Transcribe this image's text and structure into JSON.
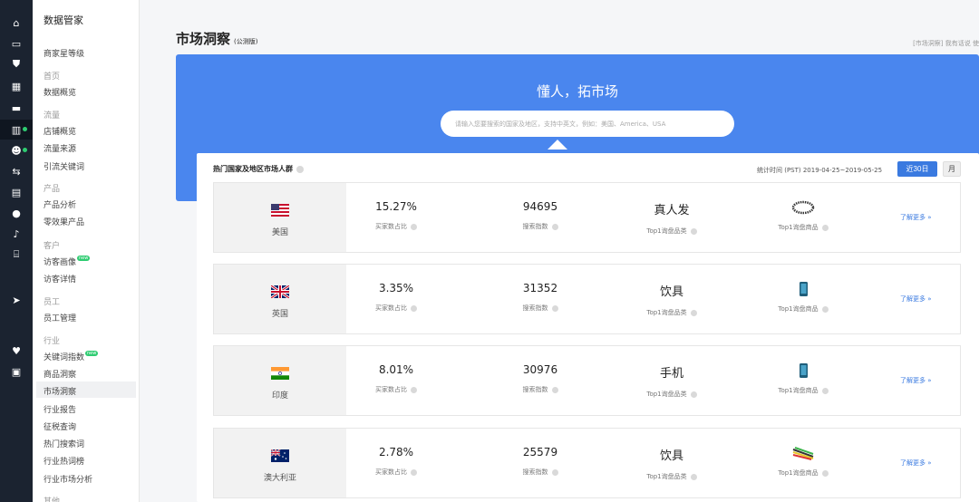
{
  "rail": {
    "icons": [
      "home-icon",
      "store-icon",
      "shield-icon",
      "grid-icon",
      "message-icon",
      "chart-icon",
      "users-icon",
      "arrows-icon",
      "clipboard-icon",
      "globe-icon",
      "bell-icon",
      "bank-icon",
      "send-icon",
      "heart-icon",
      "briefcase-icon"
    ]
  },
  "sidebar": {
    "title": "数据管家",
    "items": [
      {
        "type": "item",
        "label": "商家星等级"
      },
      {
        "type": "group",
        "label": "首页"
      },
      {
        "type": "item",
        "label": "数据概览"
      },
      {
        "type": "group",
        "label": "流量"
      },
      {
        "type": "item",
        "label": "店铺概览"
      },
      {
        "type": "item",
        "label": "流量来源"
      },
      {
        "type": "item",
        "label": "引流关键词"
      },
      {
        "type": "group",
        "label": "产品"
      },
      {
        "type": "item",
        "label": "产品分析"
      },
      {
        "type": "item",
        "label": "零效果产品"
      },
      {
        "type": "group",
        "label": "客户"
      },
      {
        "type": "item",
        "label": "访客画像",
        "badge": "new"
      },
      {
        "type": "item",
        "label": "访客详情"
      },
      {
        "type": "group",
        "label": "员工"
      },
      {
        "type": "item",
        "label": "员工管理"
      },
      {
        "type": "group",
        "label": "行业"
      },
      {
        "type": "item",
        "label": "关键词指数",
        "badge": "new"
      },
      {
        "type": "item",
        "label": "商品洞察"
      },
      {
        "type": "item",
        "label": "市场洞察",
        "active": true
      },
      {
        "type": "item",
        "label": "行业报告"
      },
      {
        "type": "item",
        "label": "征税查询"
      },
      {
        "type": "item",
        "label": "热门搜索词"
      },
      {
        "type": "item",
        "label": "行业热词榜"
      },
      {
        "type": "item",
        "label": "行业市场分析"
      },
      {
        "type": "group",
        "label": "其他"
      }
    ]
  },
  "header": {
    "title": "市场洞察",
    "beta": "(公测版)",
    "links": "[市场洞察] 我有话说    使"
  },
  "hero": {
    "title": "懂人，拓市场",
    "search_placeholder": "请输入您要搜索的国家及地区，支持中英文，例如：美国、America、USA"
  },
  "panel": {
    "title": "热门国家及地区市场人群",
    "time_label": "统计时间 (PST) 2019-04-25~2019-05-25",
    "btn_30": "近30日",
    "btn_month": "月",
    "labels": {
      "buyer_ratio": "买家数占比",
      "search_index": "搜索指数",
      "top_category": "Top1询盘品类",
      "top_product": "Top1询盘商品",
      "more": "了解更多 »"
    },
    "rows": [
      {
        "country": "美国",
        "flag": "us",
        "buyer_ratio": "15.27%",
        "search_index": "94695",
        "top_category": "真人发",
        "product": "hair"
      },
      {
        "country": "英国",
        "flag": "uk",
        "buyer_ratio": "3.35%",
        "search_index": "31352",
        "top_category": "饮具",
        "product": "phonecase"
      },
      {
        "country": "印度",
        "flag": "in",
        "buyer_ratio": "8.01%",
        "search_index": "30976",
        "top_category": "手机",
        "product": "phonecase"
      },
      {
        "country": "澳大利亚",
        "flag": "au",
        "buyer_ratio": "2.78%",
        "search_index": "25579",
        "top_category": "饮具",
        "product": "straws"
      }
    ]
  }
}
